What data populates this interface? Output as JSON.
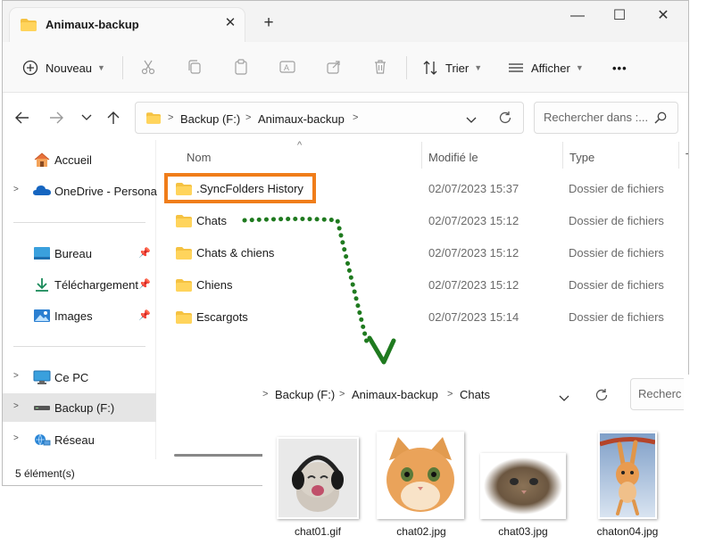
{
  "window": {
    "tab_title": "Animaux-backup",
    "close_tab": "✕",
    "new_tab": "+",
    "minimize": "—",
    "maximize": "☐",
    "close": "✕"
  },
  "toolbar": {
    "new_label": "Nouveau",
    "sort_label": "Trier",
    "view_label": "Afficher",
    "more_label": "•••"
  },
  "address": {
    "drive": "Backup (F:)",
    "folder": "Animaux-backup"
  },
  "search": {
    "placeholder": "Rechercher dans :..."
  },
  "sidebar": {
    "items": [
      {
        "label": "Accueil"
      },
      {
        "label": "OneDrive - Persona"
      },
      {
        "label": "Bureau"
      },
      {
        "label": "Téléchargement"
      },
      {
        "label": "Images"
      },
      {
        "label": "Ce PC"
      },
      {
        "label": "Backup (F:)"
      },
      {
        "label": "Réseau"
      }
    ]
  },
  "columns": {
    "name": "Nom",
    "modified": "Modifié le",
    "type": "Type",
    "extra": "T"
  },
  "files": [
    {
      "name": ".SyncFolders History",
      "modified": "02/07/2023 15:37",
      "type": "Dossier de fichiers"
    },
    {
      "name": "Chats",
      "modified": "02/07/2023 15:12",
      "type": "Dossier de fichiers"
    },
    {
      "name": "Chats & chiens",
      "modified": "02/07/2023 15:12",
      "type": "Dossier de fichiers"
    },
    {
      "name": "Chiens",
      "modified": "02/07/2023 15:12",
      "type": "Dossier de fichiers"
    },
    {
      "name": "Escargots",
      "modified": "02/07/2023 15:14",
      "type": "Dossier de fichiers"
    }
  ],
  "status": {
    "count": "5 élément(s)"
  },
  "second_window": {
    "crumbs": [
      "Backup (F:)",
      "Animaux-backup",
      "Chats"
    ],
    "search_placeholder": "Recherc",
    "thumbnails": [
      {
        "label": "chat01.gif"
      },
      {
        "label": "chat02.jpg"
      },
      {
        "label": "chat03.jpg"
      },
      {
        "label": "chaton04.jpg"
      }
    ]
  },
  "colors": {
    "highlight": "#f07d1a",
    "arrow": "#1f7a1f",
    "folder": "#f5c242"
  },
  "icons": [
    "folder-icon",
    "new-icon",
    "cut-icon",
    "copy-icon",
    "paste-icon",
    "rename-icon",
    "share-icon",
    "delete-icon",
    "sort-icon",
    "view-icon",
    "back-icon",
    "forward-icon",
    "up-icon",
    "refresh-icon",
    "search-icon",
    "home-icon",
    "onedrive-icon",
    "desktop-icon",
    "download-icon",
    "images-icon",
    "pc-icon",
    "drive-icon",
    "network-icon",
    "pin-icon"
  ]
}
